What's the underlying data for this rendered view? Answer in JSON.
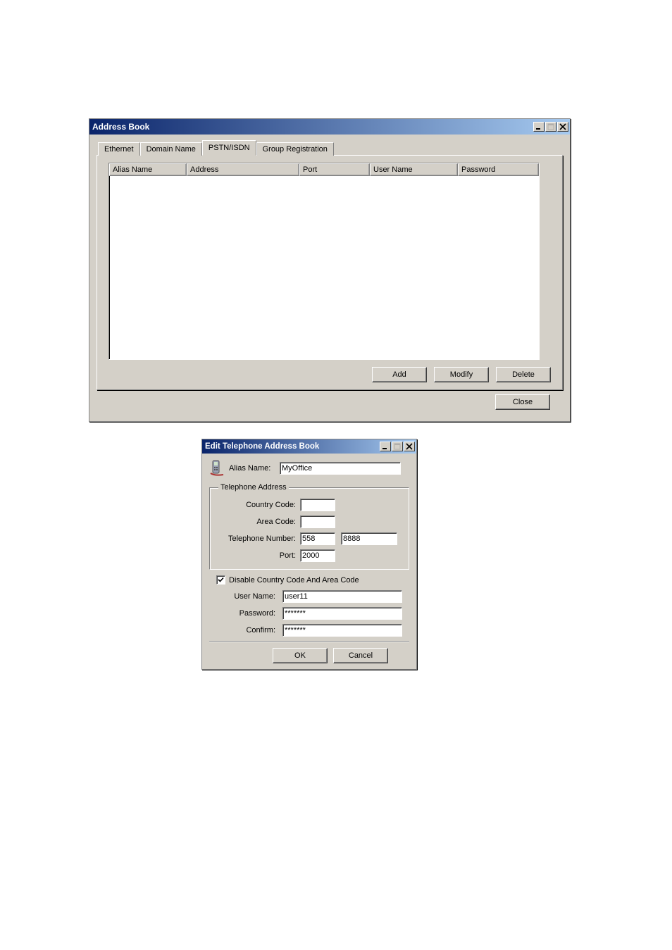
{
  "window1": {
    "title": "Address Book",
    "tabs": [
      "Ethernet",
      "Domain Name",
      "PSTN/ISDN",
      "Group Registration"
    ],
    "active_tab": 2,
    "columns": [
      "Alias Name",
      "Address",
      "Port",
      "User Name",
      "Password"
    ],
    "rows": [],
    "buttons": {
      "add": "Add",
      "modify": "Modify",
      "delete": "Delete"
    },
    "close": "Close"
  },
  "window2": {
    "title": "Edit Telephone Address Book",
    "alias_label": "Alias Name:",
    "alias_value": "MyOffice",
    "group_label": "Telephone Address",
    "country_code_label": "Country Code:",
    "country_code_value": "",
    "area_code_label": "Area Code:",
    "area_code_value": "",
    "tel_label": "Telephone Number:",
    "tel_prefix": "558",
    "tel_number": "8888",
    "port_label": "Port:",
    "port_value": "2000",
    "disable_cc_label": "Disable Country Code And Area Code",
    "disable_cc_checked": true,
    "username_label": "User Name:",
    "username_value": "user11",
    "password_label": "Password:",
    "password_value": "*******",
    "confirm_label": "Confirm:",
    "confirm_value": "*******",
    "ok": "OK",
    "cancel": "Cancel"
  }
}
